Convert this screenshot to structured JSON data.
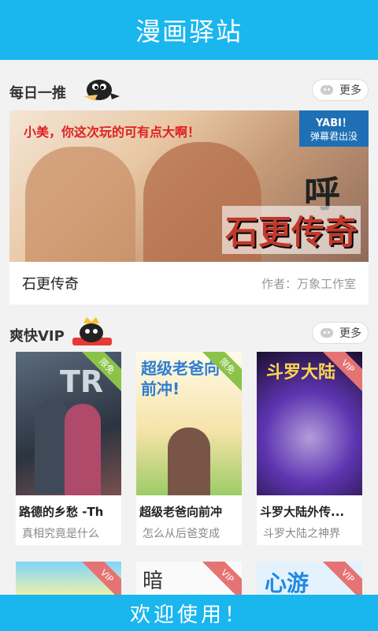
{
  "header": {
    "title": "漫画驿站"
  },
  "daily": {
    "section_title": "每日一推",
    "more_label": "更多",
    "banner_speech": "小美，你这次玩的可有点大啊！",
    "banner_badge_top": "YABI！",
    "banner_badge_bottom": "弹幕君出没",
    "banner_sfx": "呼",
    "banner_title": "石更传奇",
    "comic_name": "石更传奇",
    "author": "作者：万象工作室"
  },
  "vip": {
    "section_title": "爽快VIP",
    "more_label": "更多",
    "cards": [
      {
        "title": "路德的乡愁 -Th",
        "desc": "真相究竟是什么",
        "tag": "限免",
        "tag_color": "#8bc34a",
        "cover_text": "TR"
      },
      {
        "title": "超级老爸向前冲",
        "desc": "怎么从后爸变成",
        "tag": "限免",
        "tag_color": "#8bc34a",
        "cover_text": "超级老爸向前冲!"
      },
      {
        "title": "斗罗大陆外传...",
        "desc": "斗罗大陆之神界",
        "tag": "VIP",
        "tag_color": "#e57373",
        "cover_text": "斗罗大陆"
      }
    ],
    "row2": [
      {
        "tag": "VIP",
        "tag_color": "#e57373"
      },
      {
        "tag": "VIP",
        "tag_color": "#e57373",
        "cover_text": "暗"
      },
      {
        "tag": "VIP",
        "tag_color": "#e57373",
        "cover_text": "心游"
      }
    ]
  },
  "footer": {
    "welcome": "欢迎使用！"
  }
}
